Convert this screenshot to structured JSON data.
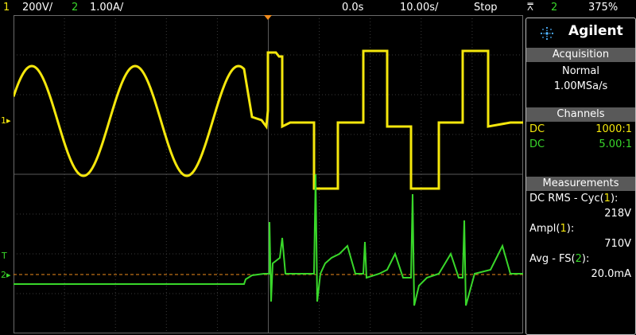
{
  "status_bar": {
    "ch1_num": "1",
    "ch1_scale": "200V/",
    "ch2_num": "2",
    "ch2_scale": "1.00A/",
    "time_offset": "0.0s",
    "time_scale": "10.00s/",
    "run_state": "Stop",
    "trigger_source": "2",
    "trigger_level": "375%"
  },
  "panel": {
    "brand": "Agilent",
    "acquisition": {
      "title": "Acquisition",
      "mode": "Normal",
      "sample_rate": "1.00MSa/s"
    },
    "channels": {
      "title": "Channels",
      "rows": [
        {
          "coupling": "DC",
          "probe": "1000:1",
          "color": "#f5e70c"
        },
        {
          "coupling": "DC",
          "probe": "5.00:1",
          "color": "#39d72a"
        }
      ]
    },
    "measurements": {
      "title": "Measurements",
      "items": [
        {
          "label_pre": "DC RMS - Cyc(",
          "channel": "1",
          "label_post": "):",
          "value": "218V",
          "color": "#f5e70c"
        },
        {
          "label_pre": "Ampl(",
          "channel": "1",
          "label_post": "):",
          "value": "710V",
          "color": "#f5e70c"
        },
        {
          "label_pre": "Avg - FS(",
          "channel": "2",
          "label_post": "):",
          "value": "20.0mA",
          "color": "#39d72a"
        }
      ]
    }
  },
  "markers": {
    "ch1": "1",
    "ch2": "2",
    "trigger": "T"
  },
  "colors": {
    "ch1": "#f5e70c",
    "ch2": "#39d72a",
    "trigger_marker": "#f08b1c",
    "grid": "#3a3a3a"
  }
}
